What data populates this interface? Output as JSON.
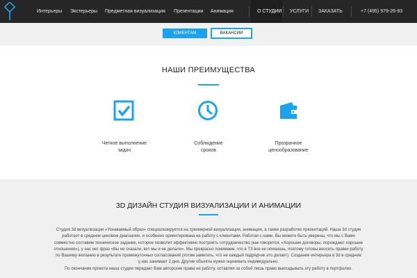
{
  "header": {
    "nav_left": [
      "Интерьеры",
      "Экстерьеры",
      "Предметная визуализация",
      "Презентации",
      "Анимация"
    ],
    "nav_right": [
      "О СТУДИИ",
      "УСЛУГИ",
      "ЗАКАЗАТЬ"
    ],
    "phone": "+7 (495) 979-26-93"
  },
  "subnav": {
    "clients_label": "КЛИЕНТАМ",
    "vacancies_label": "ВАКАНСИИ"
  },
  "advantages": {
    "title": "НАШИ ПРЕИМУЩЕСТВА",
    "items": [
      {
        "icon": "checkbox-icon",
        "line1": "Четкое выполнение",
        "line2": "задач"
      },
      {
        "icon": "clock-icon",
        "line1": "Соблюдение",
        "line2": "сроков"
      },
      {
        "icon": "wallet-icon",
        "line1": "Прозрачное",
        "line2": "ценообразование"
      }
    ]
  },
  "studio": {
    "title": "3D ДИЗАЙН СТУДИЯ ВИЗУАЛИЗАЦИИ И АНИМАЦИИ",
    "lines": [
      "Студия 3d визуализации «Узнаваемый образ» специализируется на трехмерной визуализации, анимации, а также разработке презентаций. Наша 3d студия",
      "работает в среднем ценовом диапазоне, и особенно ориентирована на работу с клиентами. Работая с нами, Вы можете быть уверены, что мы с Вами",
      "совместно составим техническое задание, которое позволит эффективно построить сотрудничество (как говорится, «Хорошие договоры, порождают хорошие",
      "отношения»), у нас нет фраз «Вы не сказали, вот мы и не делали». Мы прекрасно понимаем, что в ТЗ все не опишешь, поэтому готовы вносить правки работу",
      "по Вашему желанию в результате промежуточных согласований (хотим заметить, что не каждый подрядчик это делает). Создание интерьера в 3d в среднем",
      "у нас занимает 2 дня. Другие объекты нужно оценивать индивидуально.",
      "По окончании проекта наша студия передает Вам авторские права на работу, оставляя за собой лишь право выкладывать эту работу в портфолио."
    ]
  },
  "colors": {
    "accent": "#1aa3f0",
    "header_bg": "#262626",
    "gray_bg": "#f0f0f0"
  }
}
